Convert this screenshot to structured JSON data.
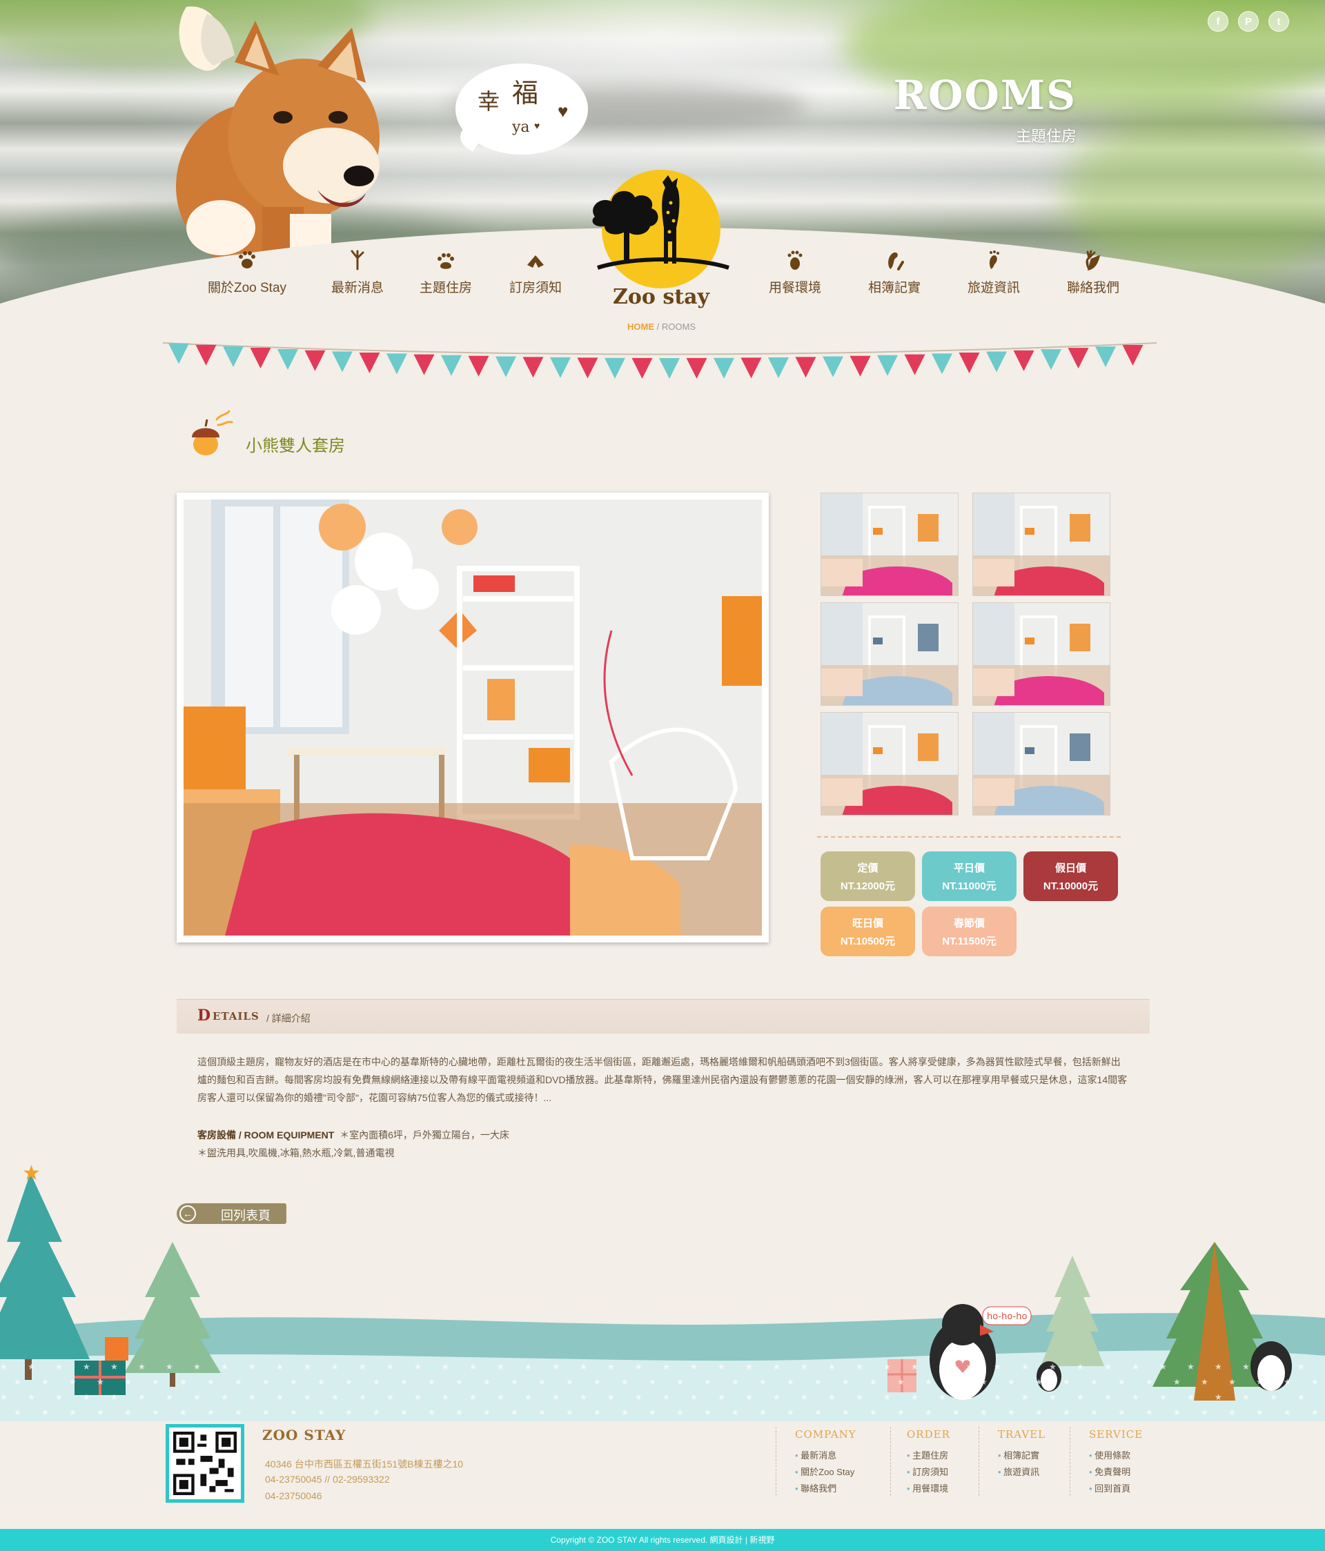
{
  "header": {
    "bubble": {
      "char1": "幸",
      "char2": "福",
      "ya": "ya"
    },
    "title_en": "ROOMS",
    "title_zh": "主題住房",
    "social": [
      "f",
      "P",
      "t"
    ]
  },
  "nav": {
    "items": [
      {
        "label": "關於Zoo Stay",
        "icon": "paw-icon"
      },
      {
        "label": "最新消息",
        "icon": "bird-foot-icon"
      },
      {
        "label": "主題住房",
        "icon": "cat-paw-icon"
      },
      {
        "label": "訂房須知",
        "icon": "hoof-icon"
      },
      {
        "label": "用餐環境",
        "icon": "bear-paw-icon"
      },
      {
        "label": "相簿記實",
        "icon": "footprint-icon"
      },
      {
        "label": "旅遊資訊",
        "icon": "foot-icon"
      },
      {
        "label": "聯絡我們",
        "icon": "hand-icon"
      }
    ],
    "logo_text": "Zoo  stay"
  },
  "breadcrumb": {
    "home": "HOME",
    "sep": "/",
    "current": "ROOMS"
  },
  "room": {
    "title": "小熊雙人套房",
    "prices": [
      {
        "label": "定價",
        "value": "NT.12000元",
        "color": "#c4bd8f"
      },
      {
        "label": "平日價",
        "value": "NT.11000元",
        "color": "#6ccacb"
      },
      {
        "label": "假日價",
        "value": "NT.10000元",
        "color": "#aa3a3c"
      },
      {
        "label": "旺日價",
        "value": "NT.10500元",
        "color": "#f8b66c"
      },
      {
        "label": "春節價",
        "value": "NT.11500元",
        "color": "#f7bb9e"
      }
    ]
  },
  "details": {
    "head_big": "D",
    "head_rest": "ETAILS",
    "head_zh": "/ 詳細介紹",
    "paragraph": "這個頂級主題房，寵物友好的酒店是在市中心的基韋斯特的心臟地帶，距離杜瓦爾街的夜生活半個街區，距離邂逅處，瑪格麗塔維爾和帆船碼頭酒吧不到3個街區。客人將享受健康，多為器質性歐陸式早餐，包括新鮮出爐的麵包和百吉餅。每間客房均設有免費無線網絡連接以及帶有線平面電視頻道和DVD播放器。此基韋斯特，佛羅里達州民宿內還設有鬱鬱蔥蔥的花園一個安靜的綠洲，客人可以在那裡享用早餐或只是休息，這家14間客房客人還可以保留為你的婚禮\"司令部\"，花園可容納75位客人為您的儀式或接待！...",
    "equip_label": "客房設備 / ROOM EQUIPMENT",
    "equip_line1": "＊室內面積6坪，戶外獨立陽台，一大床",
    "equip_line2": "＊盥洗用具,吹風機,冰箱,熱水瓶,冷氣,普通電視"
  },
  "back_button": "回列表頁",
  "scene": {
    "speech": "ho-ho-ho"
  },
  "footer": {
    "company": "ZOO STAY",
    "address": "40346 台中市西區五權五街151號B棟五樓之10",
    "phone": "04-23750045 // 02-29593322",
    "fax": "04-23750046",
    "columns": [
      {
        "title": "COMPANY",
        "items": [
          "最新消息",
          "關於Zoo Stay",
          "聯絡我們"
        ]
      },
      {
        "title": "ORDER",
        "items": [
          "主題住房",
          "訂房須知",
          "用餐環境"
        ]
      },
      {
        "title": "TRAVEL",
        "items": [
          "相簿記實",
          "旅遊資訊"
        ]
      },
      {
        "title": "SERVICE",
        "items": [
          "使用條款",
          "免責聲明",
          "回到首頁"
        ]
      }
    ],
    "copyright": "Copyright © ZOO STAY All rights reserved.     網頁設計  |  新視野"
  },
  "colors": {
    "accent": "#2bd1d1",
    "title_green": "#7f8a22",
    "brown": "#6d4a22"
  }
}
